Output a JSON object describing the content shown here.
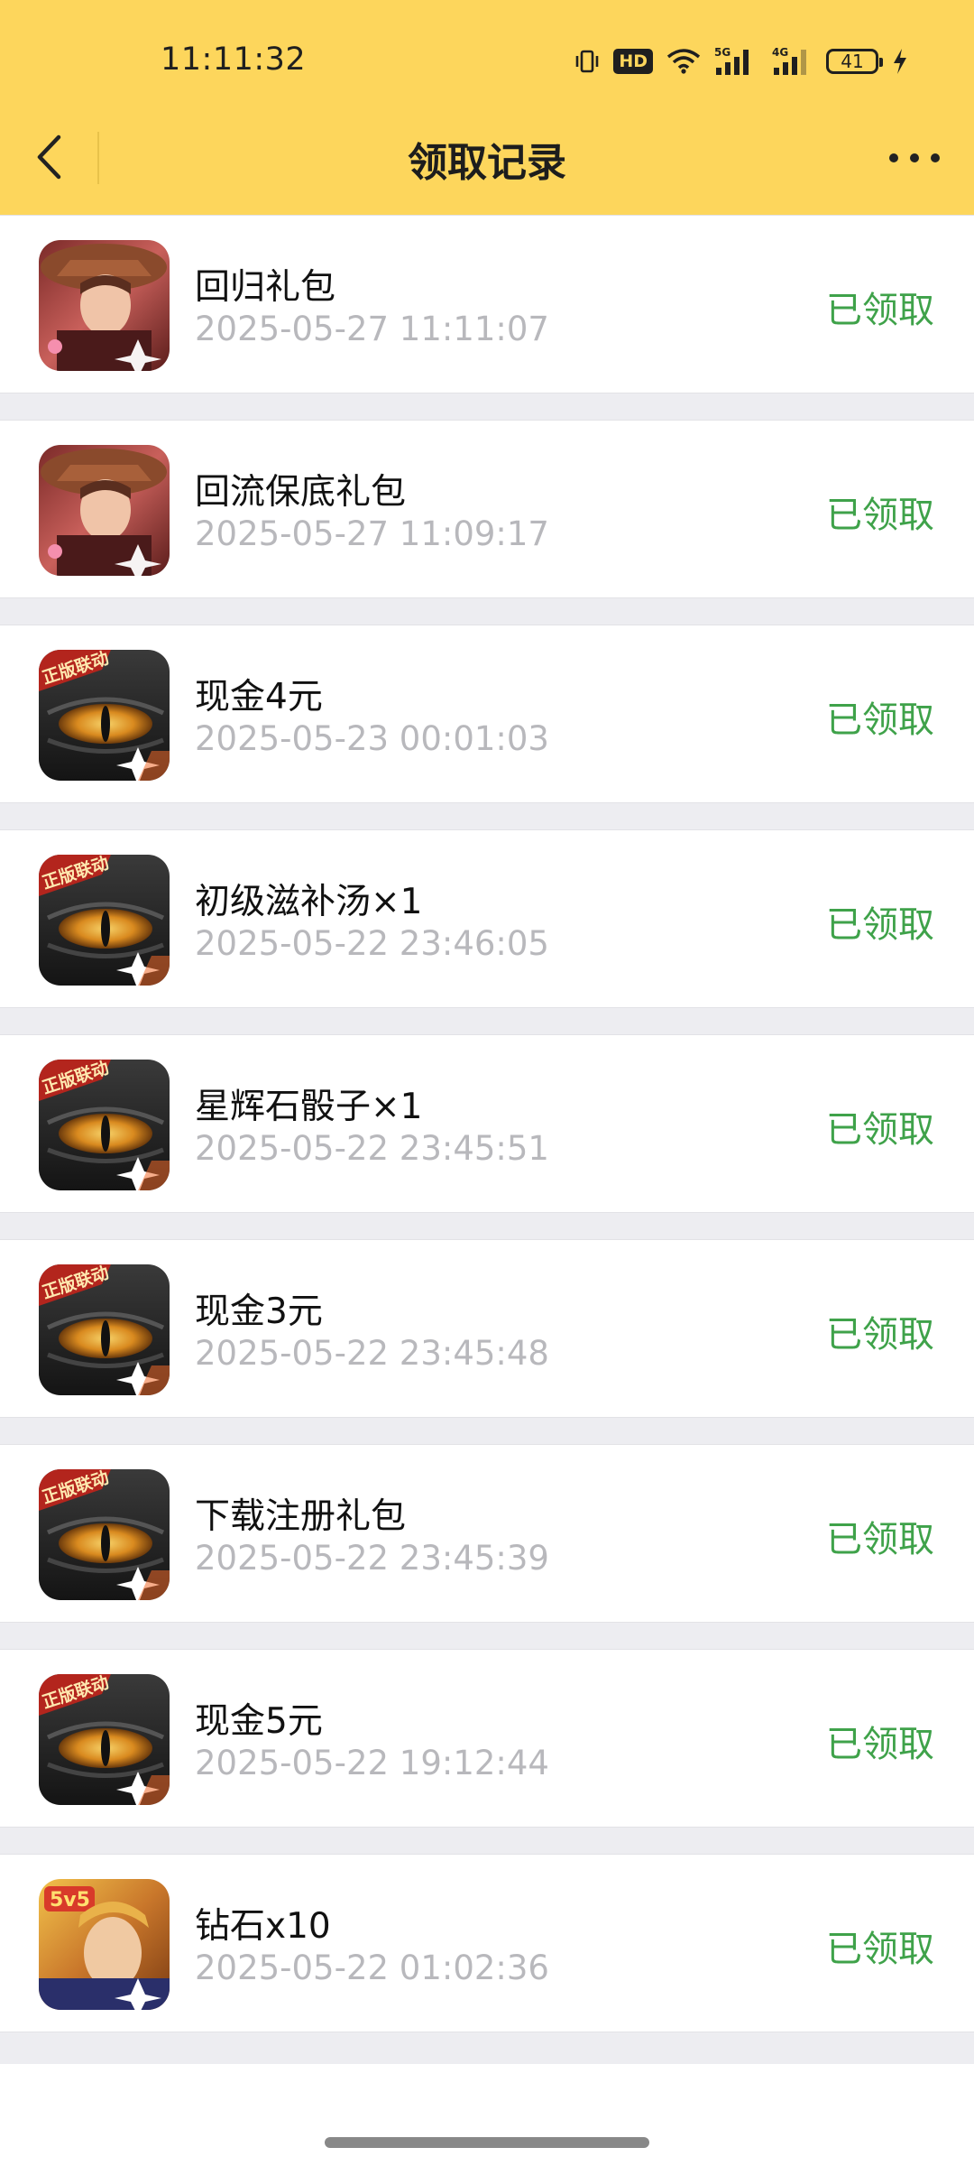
{
  "status_bar": {
    "time": "11:11:32",
    "battery": "41",
    "icons": [
      "vibrate-icon",
      "hd-icon",
      "wifi-icon",
      "5g-signal-icon",
      "4g-signal-icon",
      "battery-icon",
      "charging-icon"
    ],
    "hd": "HD",
    "net1": "5G",
    "net2": "4G"
  },
  "nav": {
    "title": "领取记录",
    "back_icon": "chevron-left-icon",
    "more_icon": "more-dots-icon"
  },
  "colors": {
    "header_bg": "#fdd65c",
    "status_green": "#3fa24a",
    "time_gray": "#b8b8bc"
  },
  "records": [
    {
      "title": "回归礼包",
      "time": "2025-05-27 11:11:07",
      "status": "已领取",
      "icon": "game-icon-hero"
    },
    {
      "title": "回流保底礼包",
      "time": "2025-05-27 11:09:17",
      "status": "已领取",
      "icon": "game-icon-hero"
    },
    {
      "title": "现金4元",
      "time": "2025-05-23 00:01:03",
      "status": "已领取",
      "icon": "game-icon-dragon-eye"
    },
    {
      "title": "初级滋补汤×1",
      "time": "2025-05-22 23:46:05",
      "status": "已领取",
      "icon": "game-icon-dragon-eye"
    },
    {
      "title": "星辉石骰子×1",
      "time": "2025-05-22 23:45:51",
      "status": "已领取",
      "icon": "game-icon-dragon-eye"
    },
    {
      "title": "现金3元",
      "time": "2025-05-22 23:45:48",
      "status": "已领取",
      "icon": "game-icon-dragon-eye"
    },
    {
      "title": "下载注册礼包",
      "time": "2025-05-22 23:45:39",
      "status": "已领取",
      "icon": "game-icon-dragon-eye"
    },
    {
      "title": "现金5元",
      "time": "2025-05-22 19:12:44",
      "status": "已领取",
      "icon": "game-icon-dragon-eye"
    },
    {
      "title": "钻石x10",
      "time": "2025-05-22 01:02:36",
      "status": "已领取",
      "icon": "game-icon-5v5"
    }
  ]
}
